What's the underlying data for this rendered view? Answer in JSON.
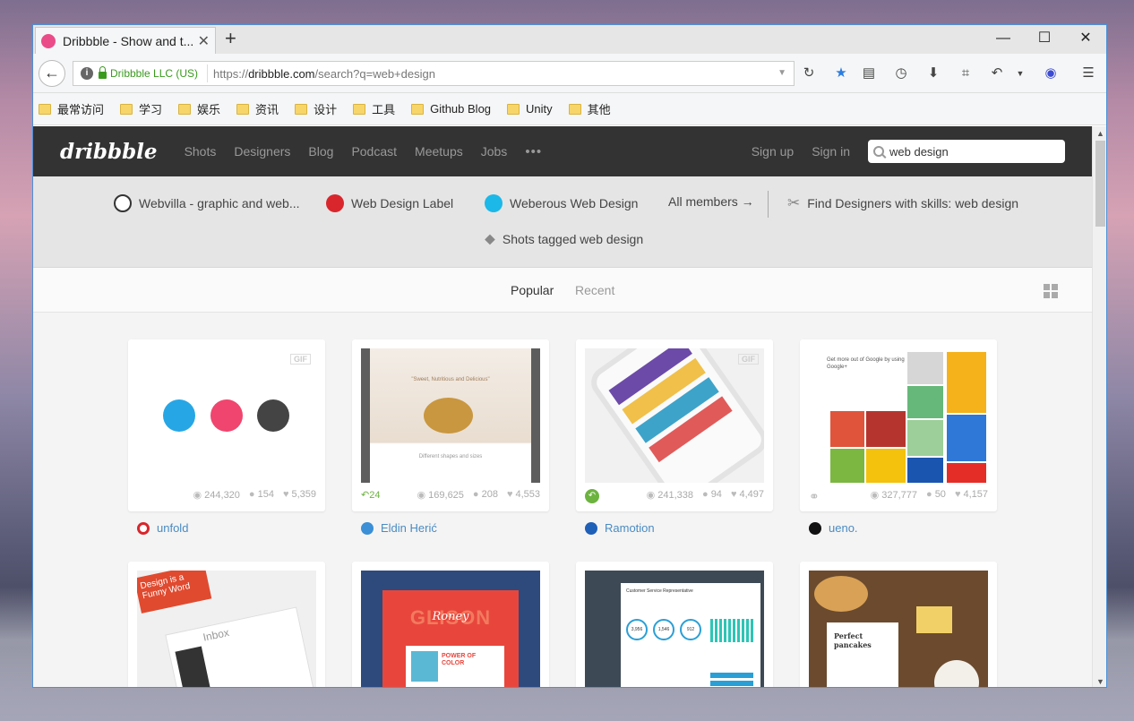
{
  "browser": {
    "tab_title": "Dribbble - Show and t...",
    "org": "Dribbble LLC (US)",
    "url_prefix": "https://",
    "url_host": "dribbble.com",
    "url_path": "/search?q=web+design"
  },
  "bookmarks": [
    "最常访问",
    "学习",
    "娱乐",
    "资讯",
    "设计",
    "工具",
    "Github Blog",
    "Unity",
    "其他"
  ],
  "header": {
    "logo": "dribbble",
    "nav": [
      "Shots",
      "Designers",
      "Blog",
      "Podcast",
      "Meetups",
      "Jobs"
    ],
    "more": "•••",
    "signup": "Sign up",
    "signin": "Sign in",
    "search_value": "web design"
  },
  "related": {
    "member1": "Webvilla - graphic and web...",
    "member2": "Web Design Label",
    "member3": "Weberous Web Design",
    "all_members": "All members →",
    "find_designers": "Find Designers with skills: web design",
    "shots_tagged": "Shots tagged web design"
  },
  "sort": {
    "popular": "Popular",
    "recent": "Recent"
  },
  "shots": [
    {
      "author": "unfold",
      "views": "244,320",
      "comments": "154",
      "likes": "5,359",
      "gif": "GIF",
      "rebounds": "",
      "avatar_color": "#d9262c"
    },
    {
      "author": "Eldin Herić",
      "views": "169,625",
      "comments": "208",
      "likes": "4,553",
      "gif": "",
      "rebounds": "24",
      "avatar_color": "#3a8fd6"
    },
    {
      "author": "Ramotion",
      "views": "241,338",
      "comments": "94",
      "likes": "4,497",
      "gif": "GIF",
      "rebounds": "",
      "avatar_color": "#1e5fb8"
    },
    {
      "author": "ueno.",
      "views": "327,777",
      "comments": "50",
      "likes": "4,157",
      "gif": "",
      "rebounds": "",
      "avatar_color": "#111111"
    }
  ],
  "second_row": {
    "s1_title": "Design is a Funny Word",
    "s1_inbox": "Inbox",
    "s2_brand": "GLISON",
    "s2_script": "Roney",
    "s2_power": "POWER OF COLOR",
    "s3_title": "Customer Service Representative",
    "s3_stat1": "3,956",
    "s3_stat2": "1,546",
    "s3_stat3": "912",
    "s4_title": "Perfect pancakes"
  },
  "preview": {
    "s2_tagline": "\"Sweet, Nutritious and Delicious\"",
    "s2_caption": "Different shapes and sizes",
    "s4_heading": "Get more out of Google by using Google+"
  }
}
